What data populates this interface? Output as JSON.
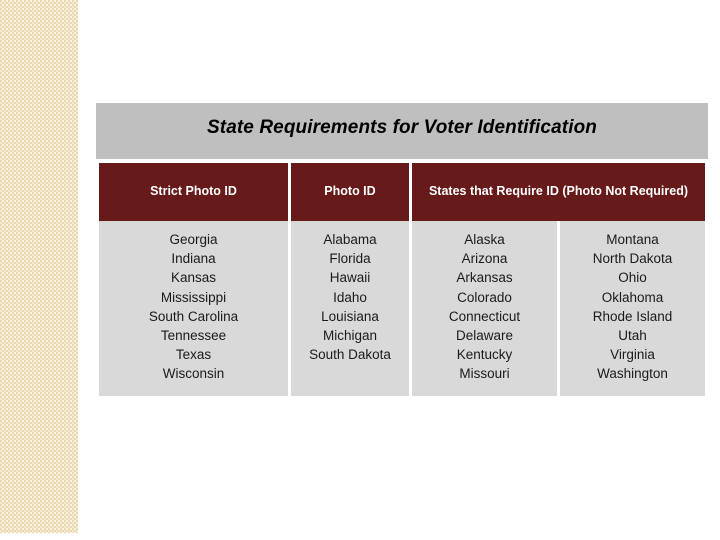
{
  "slide": {
    "title": "State Requirements for Voter Identification",
    "colors": {
      "header_red": "#661a1a",
      "title_banner_gray": "#bfbfbf",
      "cell_gray": "#d9d9d9",
      "side_strip_cream": "#f5e7c6",
      "header_text": "#ffffff",
      "body_text": "#1a1a1a"
    }
  },
  "table": {
    "headers": [
      {
        "label": "Strict Photo ID",
        "colspan": 1
      },
      {
        "label": "Photo ID",
        "colspan": 1
      },
      {
        "label": "States that Require ID (Photo Not Required)",
        "colspan": 2
      }
    ],
    "columns": [
      {
        "header": "Strict Photo ID",
        "states": [
          "Georgia",
          "Indiana",
          "Kansas",
          "Mississippi",
          "South Carolina",
          "Tennessee",
          "Texas",
          "Wisconsin"
        ]
      },
      {
        "header": "Photo ID",
        "states": [
          "Alabama",
          "Florida",
          "Hawaii",
          "Idaho",
          "Louisiana",
          "Michigan",
          "South Dakota"
        ]
      },
      {
        "header": "States that Require ID (Photo Not Required)",
        "states": [
          "Alaska",
          "Arizona",
          "Arkansas",
          "Colorado",
          "Connecticut",
          "Delaware",
          "Kentucky",
          "Missouri"
        ]
      },
      {
        "header": "States that Require ID (Photo Not Required)",
        "states": [
          "Montana",
          "North Dakota",
          "Ohio",
          "Oklahoma",
          "Rhode Island",
          "Utah",
          "Virginia",
          "Washington"
        ]
      }
    ]
  }
}
